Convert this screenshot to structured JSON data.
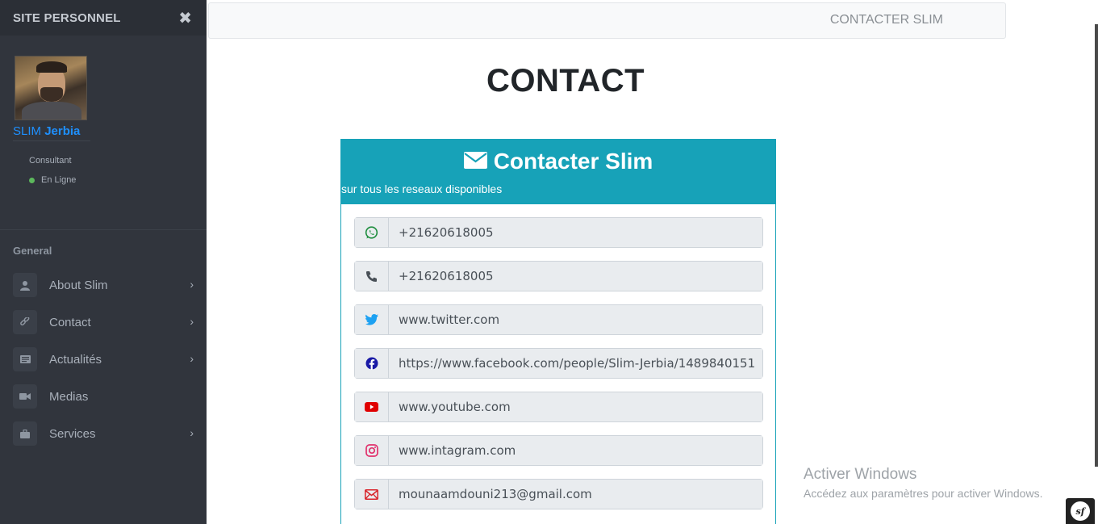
{
  "sidebar": {
    "title": "SITE PERSONNEL",
    "close_glyph": "✖",
    "profile": {
      "first_name": "SLIM",
      "last_name": "Jerbia",
      "role": "Consultant",
      "status": "En Ligne",
      "status_color": "#5cb85c"
    },
    "section_heading": "General",
    "items": [
      {
        "label": "About Slim",
        "icon": "user-icon",
        "has_chevron": true
      },
      {
        "label": "Contact",
        "icon": "link-icon",
        "has_chevron": true
      },
      {
        "label": "Actualités",
        "icon": "newspaper-icon",
        "has_chevron": true
      },
      {
        "label": "Medias",
        "icon": "video-camera-icon",
        "has_chevron": false
      },
      {
        "label": "Services",
        "icon": "briefcase-icon",
        "has_chevron": true
      }
    ],
    "chevron_glyph": "›"
  },
  "navbar": {
    "link": "CONTACTER SLIM"
  },
  "main": {
    "page_title": "CONTACT",
    "card": {
      "title": "Contacter Slim",
      "subtitle": "sur tous les reseaux disponibles",
      "accent_color": "#17a2b8",
      "fields": [
        {
          "icon": "whatsapp-icon",
          "value": "+21620618005",
          "icon_color": "#1e8e3e"
        },
        {
          "icon": "phone-icon",
          "value": "+21620618005",
          "icon_color": "#495057"
        },
        {
          "icon": "twitter-icon",
          "value": "www.twitter.com",
          "icon_color": "#1da1f2"
        },
        {
          "icon": "facebook-icon",
          "value": "https://www.facebook.com/people/Slim-Jerbia/1489840151",
          "icon_color": "#1a1aa6"
        },
        {
          "icon": "youtube-icon",
          "value": "www.youtube.com",
          "icon_color": "#e00000"
        },
        {
          "icon": "instagram-icon",
          "value": "www.intagram.com",
          "icon_color": "#e1306c"
        },
        {
          "icon": "envelope-icon",
          "value": "mounaamdouni213@gmail.com",
          "icon_color": "#d9242b"
        }
      ]
    }
  },
  "overlay": {
    "watermark_title": "Activer Windows",
    "watermark_subtitle": "Accédez aux paramètres pour activer Windows.",
    "sf_badge": "sf"
  }
}
